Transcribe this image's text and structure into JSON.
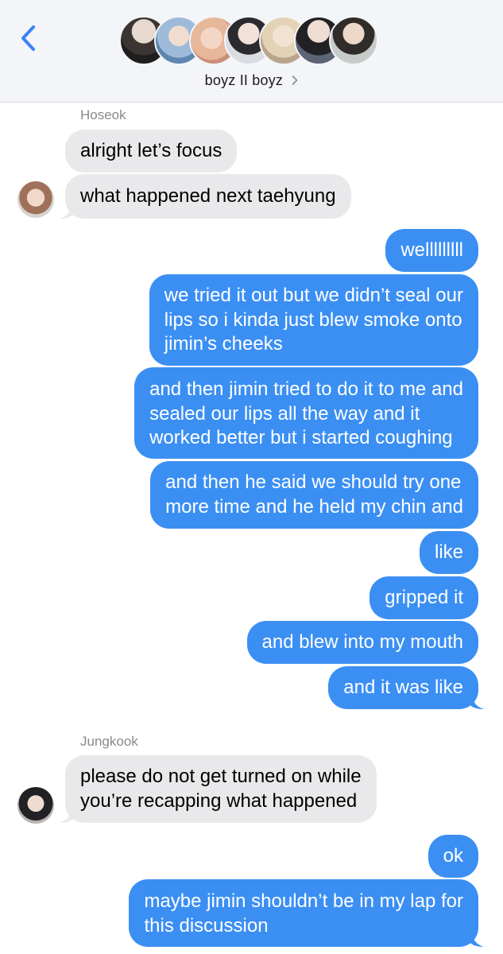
{
  "header": {
    "back_icon": "chevron-left-icon",
    "group_name": "boyz II boyz",
    "group_chevron_icon": "chevron-right-icon",
    "member_avatar_count": 7,
    "accent": "#3b82f6"
  },
  "conversation": {
    "hoseok": {
      "sender": "Hoseok",
      "messages": [
        "alright let’s focus",
        "what happened next taehyung"
      ]
    },
    "me_first": {
      "messages": [
        [
          "welllllllll"
        ],
        [
          "we tried it out but we didn’t seal our",
          "lips so i kinda just blew smoke onto",
          "jimin’s cheeks"
        ],
        [
          "and then jimin tried to do it to me and",
          "sealed our lips all the way and it",
          "worked better but i started coughing"
        ],
        [
          "and then he said we should try one",
          "more time and he held my chin and"
        ],
        [
          "like"
        ],
        [
          "gripped it"
        ],
        [
          "and blew into my mouth"
        ],
        [
          "and it was like"
        ]
      ]
    },
    "jungkook": {
      "sender": "Jungkook",
      "messages": [
        [
          "please do not get turned on while",
          "you’re recapping what happened"
        ]
      ]
    },
    "me_second": {
      "messages": [
        [
          "ok"
        ],
        [
          "maybe jimin shouldn’t be in my lap for",
          "this discussion"
        ]
      ]
    }
  },
  "colors": {
    "incoming_bubble": "#e9e9eb",
    "outgoing_bubble": "#3b8ff3",
    "header_bg": "#f4f5f8",
    "sender_label": "#8a8a8e"
  }
}
